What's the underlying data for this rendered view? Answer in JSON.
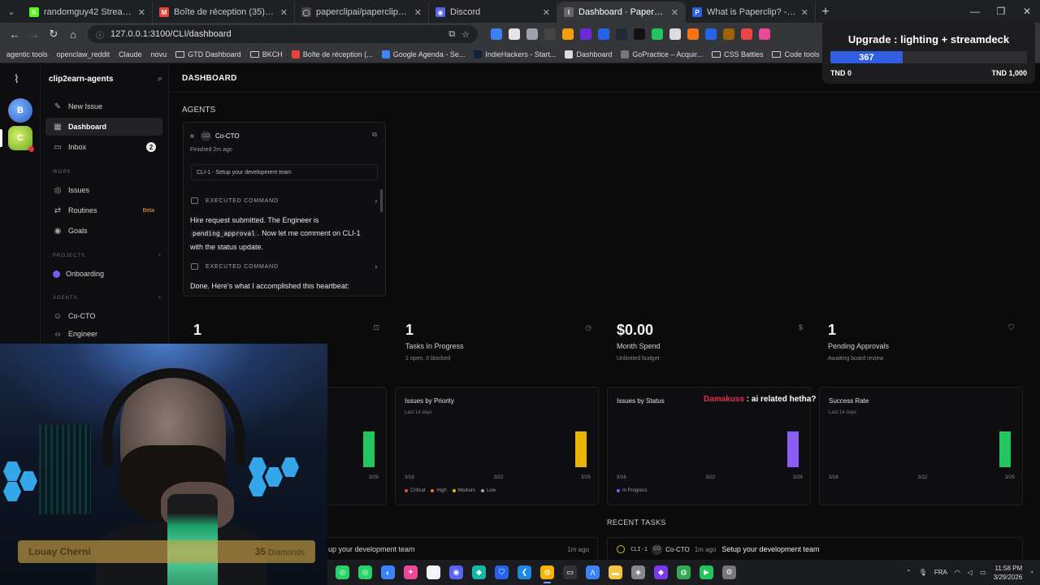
{
  "browser": {
    "tabs": [
      {
        "label": "randomguy42 Stream - Watch l",
        "fav_color": "#53fc18",
        "fav_glyph": "K",
        "active": false
      },
      {
        "label": "Boîte de réception (35) - gharb",
        "fav_color": "#ea4335",
        "fav_glyph": "M",
        "active": false
      },
      {
        "label": "paperclipai/paperclip: Open-so",
        "fav_color": "#444",
        "fav_glyph": "◯",
        "active": false
      },
      {
        "label": "Discord",
        "fav_color": "#5865f2",
        "fav_glyph": "◉",
        "active": false
      },
      {
        "label": "Dashboard · Paperclip",
        "fav_color": "#666",
        "fav_glyph": "⌇",
        "active": true
      },
      {
        "label": "What is Paperclip? - Paperclip",
        "fav_color": "#2f5fe0",
        "fav_glyph": "P",
        "active": false
      }
    ],
    "new_tab_glyph": "+",
    "url": "127.0.0.1:3100/CLI/dashboard",
    "bookmarks": [
      {
        "label": "agentic tools",
        "type": "text"
      },
      {
        "label": "openclaw_reddit",
        "type": "text"
      },
      {
        "label": "Claude",
        "type": "text"
      },
      {
        "label": "novu",
        "type": "text"
      },
      {
        "label": "GTD Dashboard",
        "type": "folder"
      },
      {
        "label": "BKCH",
        "type": "folder"
      },
      {
        "label": "Boîte de réception (...",
        "type": "icon",
        "color": "#ea4335"
      },
      {
        "label": "Google Agenda - Se...",
        "type": "icon",
        "color": "#4285f4"
      },
      {
        "label": "IndieHackers - Start...",
        "type": "icon",
        "color": "#0e2439"
      },
      {
        "label": "Dashboard",
        "type": "icon",
        "color": "#ddd"
      },
      {
        "label": "GoPractice – Acquir...",
        "type": "icon",
        "color": "#777"
      },
      {
        "label": "CSS Battles",
        "type": "folder"
      },
      {
        "label": "Code tools",
        "type": "folder"
      },
      {
        "label": "Ho",
        "type": "icon",
        "color": "#f5c518"
      }
    ]
  },
  "app": {
    "company_name": "clip2earn-agents",
    "workspaces": [
      "B",
      "C"
    ],
    "page_title": "DASHBOARD",
    "nav": {
      "new_issue": "New Issue",
      "dashboard": "Dashboard",
      "inbox": "Inbox",
      "inbox_count": "2",
      "work_section": "WORK",
      "issues": "Issues",
      "routines": "Routines",
      "routines_badge": "Beta",
      "goals": "Goals",
      "projects_section": "PROJECTS",
      "project_onboarding": "Onboarding",
      "agents_section": "AGENTS",
      "agent_cocto": "Co-CTO",
      "agent_engineer": "Engineer",
      "add_glyph": "+"
    },
    "agents_heading": "AGENTS",
    "agent_card": {
      "avatar": "CO",
      "name": "Co-CTO",
      "status": "Finished 2m ago",
      "task": "CLI-1 - Setup your development team",
      "cmd_label_1": "EXECUTED COMMAND",
      "msg_1_a": "Hire request submitted. The Engineer is",
      "msg_1_code": "pending_approval",
      "msg_1_b": ". Now let me comment on CLI-1 with the status update.",
      "cmd_label_2": "EXECUTED COMMAND",
      "msg_2": "Done. Here's what I accomplished this heartbeat:"
    },
    "stats": [
      {
        "value": "1",
        "label": "",
        "desc": "",
        "icon": "bot-icon"
      },
      {
        "value": "1",
        "label": "Tasks In Progress",
        "desc": "1 open, 0 blocked",
        "icon": "progress-icon"
      },
      {
        "value": "$0.00",
        "label": "Month Spend",
        "desc": "Unlimited budget",
        "icon": "dollar-icon"
      },
      {
        "value": "1",
        "label": "Pending Approvals",
        "desc": "Awaiting board review",
        "icon": "shield-icon"
      }
    ],
    "recent_tasks_heading": "RECENT TASKS",
    "recent_task": {
      "id": "CLI-1",
      "avatar": "CO",
      "who": "Co-CTO",
      "time": "1m ago",
      "title": "Setup your development team"
    },
    "left_activity": {
      "text": "up your development team",
      "time": "1m ago"
    }
  },
  "chart_data": [
    {
      "type": "bar",
      "title": "",
      "subtitle": "",
      "categories": [
        "3/16",
        "3/22",
        "3/29"
      ],
      "x_tick_labels": [
        "",
        "3/29"
      ],
      "values": [
        0,
        0,
        1
      ],
      "color": "#22c55e"
    },
    {
      "type": "bar",
      "title": "Issues by Priority",
      "subtitle": "Last 14 days",
      "categories": [
        "3/16",
        "3/22",
        "3/29"
      ],
      "x_tick_labels": [
        "3/16",
        "3/22",
        "3/29"
      ],
      "series": [
        {
          "name": "Critical",
          "color": "#ef4444",
          "values": [
            0,
            0,
            0
          ]
        },
        {
          "name": "High",
          "color": "#f97316",
          "values": [
            0,
            0,
            0
          ]
        },
        {
          "name": "Medium",
          "color": "#eab308",
          "values": [
            0,
            0,
            1
          ]
        },
        {
          "name": "Low",
          "color": "#9ca3af",
          "values": [
            0,
            0,
            0
          ]
        }
      ]
    },
    {
      "type": "bar",
      "title": "Issues by Status",
      "subtitle": "",
      "categories": [
        "3/16",
        "3/22",
        "3/29"
      ],
      "x_tick_labels": [
        "3/16",
        "3/22",
        "3/29"
      ],
      "series": [
        {
          "name": "In Progress",
          "color": "#8b5cf6",
          "values": [
            0,
            0,
            1
          ]
        }
      ]
    },
    {
      "type": "bar",
      "title": "Success Rate",
      "subtitle": "Last 14 days",
      "categories": [
        "3/16",
        "3/22",
        "3/29"
      ],
      "x_tick_labels": [
        "3/16",
        "3/22",
        "3/29"
      ],
      "values": [
        0,
        0,
        1
      ],
      "color": "#22c55e"
    }
  ],
  "overlays": {
    "donation": {
      "title": "Upgrade : lighting + streamdeck",
      "current": "367",
      "progress": 0.367,
      "min_label": "TND 0",
      "max_label": "TND 1,000"
    },
    "chat": {
      "user": "Damakuss",
      "text": " : ai related hetha?"
    },
    "nameplate": {
      "name": "Louay Cherni",
      "count": "35",
      "unit": "Diamonds"
    }
  },
  "taskbar": {
    "lang": "FRA",
    "time": "11:58 PM",
    "date": "3/29/2026",
    "icons": [
      {
        "name": "whatsapp-icon",
        "color": "#25d366",
        "glyph": "◎"
      },
      {
        "name": "whatsapp-business-icon",
        "color": "#25d366",
        "glyph": "◎"
      },
      {
        "name": "copilot-icon",
        "color": "#3b82f6",
        "glyph": "◐"
      },
      {
        "name": "app-icon",
        "color": "#ec4899",
        "glyph": "✦"
      },
      {
        "name": "notion-icon",
        "color": "#f3f3f3",
        "glyph": "N"
      },
      {
        "name": "discord-icon",
        "color": "#5865f2",
        "glyph": "◉"
      },
      {
        "name": "app2-icon",
        "color": "#14b8a6",
        "glyph": "◆"
      },
      {
        "name": "shield-app-icon",
        "color": "#2563eb",
        "glyph": "⛉"
      },
      {
        "name": "vscode-icon",
        "color": "#1e88e5",
        "glyph": "❮"
      },
      {
        "name": "chrome-icon",
        "color": "#f4b400",
        "glyph": "◍"
      },
      {
        "name": "terminal-icon",
        "color": "#333",
        "glyph": "▭"
      },
      {
        "name": "app3-icon",
        "color": "#3b82f6",
        "glyph": "Λ"
      },
      {
        "name": "folder-icon",
        "color": "#f5c542",
        "glyph": "▬"
      },
      {
        "name": "app4-icon",
        "color": "#888",
        "glyph": "◈"
      },
      {
        "name": "obsidian-icon",
        "color": "#7c3aed",
        "glyph": "◆"
      },
      {
        "name": "chrome2-icon",
        "color": "#34a853",
        "glyph": "◍"
      },
      {
        "name": "app5-icon",
        "color": "#22c55e",
        "glyph": "▶"
      },
      {
        "name": "settings-icon",
        "color": "#777",
        "glyph": "⚙"
      }
    ]
  }
}
